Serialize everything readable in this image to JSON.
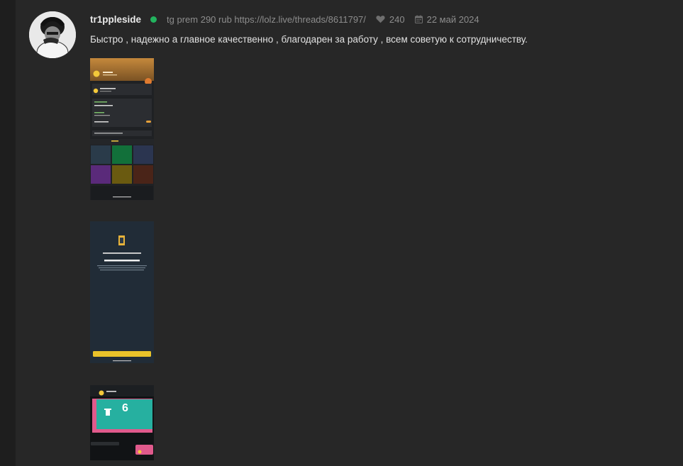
{
  "post": {
    "author": "tr1ppleside",
    "thread_link": "tg prem 290 rub https://lolz.live/threads/8611797/",
    "likes": "240",
    "date": "22 май 2024",
    "message": "Быстро , надежно а главное качественно , благодарен за работу , всем советую к сотрудничеству.",
    "online_color": "#22b35e"
  },
  "attachments": {
    "shot2": {
      "title": "Toncoin в процессе обработки",
      "amount": "1.41 TON"
    },
    "shot3": {
      "amount": "6"
    }
  },
  "icons": {
    "likes": "heart-icon",
    "date": "calendar-icon",
    "status": "online-indicator"
  }
}
